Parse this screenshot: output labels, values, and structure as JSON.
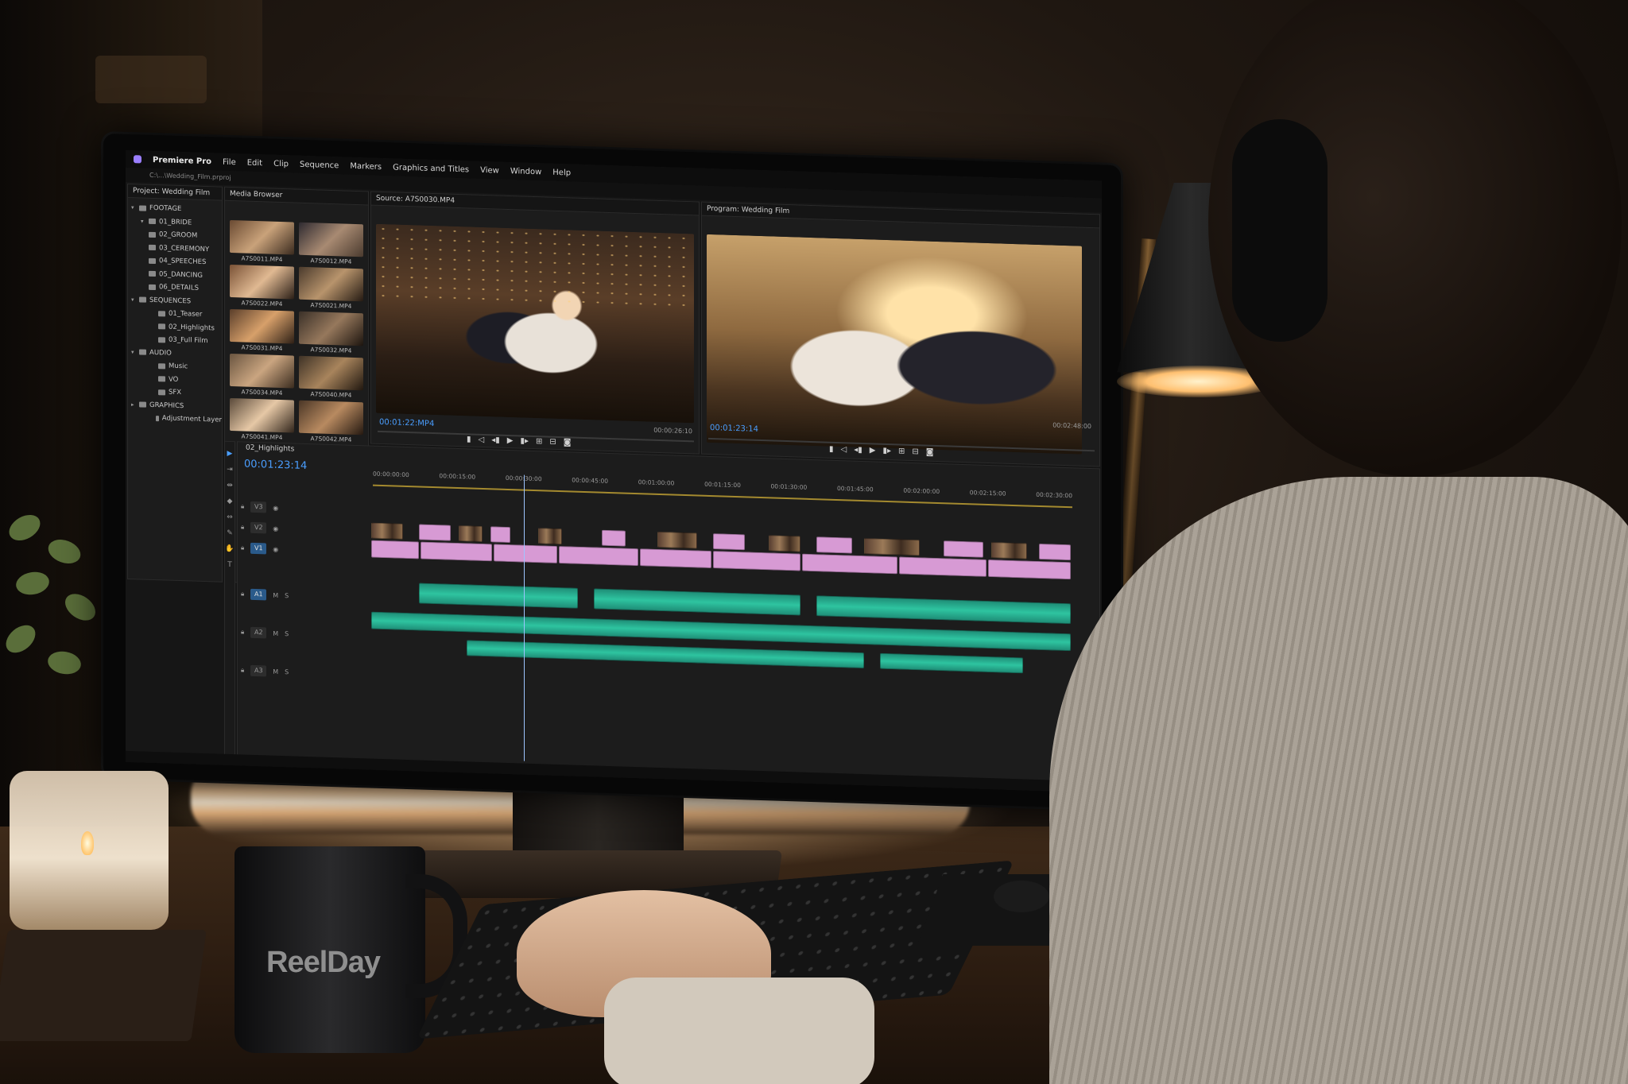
{
  "app": {
    "name": "Premiere Pro",
    "path": "C:\\...\\Wedding_Film.prproj"
  },
  "menu": [
    "File",
    "Edit",
    "Clip",
    "Sequence",
    "Markers",
    "Graphics and Titles",
    "View",
    "Window",
    "Help"
  ],
  "project_panel": {
    "title": "Project: Wedding Film",
    "tree": [
      {
        "label": "FOOTAGE",
        "level": 0,
        "open": true
      },
      {
        "label": "01_BRIDE",
        "level": 1,
        "open": true
      },
      {
        "label": "02_GROOM",
        "level": 1
      },
      {
        "label": "03_CEREMONY",
        "level": 1
      },
      {
        "label": "04_SPEECHES",
        "level": 1
      },
      {
        "label": "05_DANCING",
        "level": 1
      },
      {
        "label": "06_DETAILS",
        "level": 1
      },
      {
        "label": "SEQUENCES",
        "level": 0,
        "open": true
      },
      {
        "label": "01_Teaser",
        "level": 2
      },
      {
        "label": "02_Highlights",
        "level": 2
      },
      {
        "label": "03_Full Film",
        "level": 2
      },
      {
        "label": "AUDIO",
        "level": 0,
        "open": true
      },
      {
        "label": "Music",
        "level": 2
      },
      {
        "label": "VO",
        "level": 2
      },
      {
        "label": "SFX",
        "level": 2
      },
      {
        "label": "GRAPHICS",
        "level": 0
      },
      {
        "label": "Adjustment Layer",
        "level": 2
      }
    ]
  },
  "media_browser": {
    "title": "Media Browser",
    "thumbnails": [
      "A7S0011.MP4",
      "A7S0012.MP4",
      "A7S0022.MP4",
      "A7S0021.MP4",
      "A7S0031.MP4",
      "A7S0032.MP4",
      "A7S0034.MP4",
      "A7S0040.MP4",
      "A7S0041.MP4",
      "A7S0042.MP4"
    ]
  },
  "source_monitor": {
    "title": "Source: A7S0030.MP4",
    "timecode": "00:01:22:MP4",
    "duration": "00:00:26:10"
  },
  "program_monitor": {
    "title": "Program: Wedding Film",
    "timecode": "00:01:23:14",
    "duration": "00:02:48:00"
  },
  "timeline": {
    "sequence": "02_Highlights",
    "timecode": "00:01:23:14",
    "ruler": [
      "00:00:00:00",
      "00:00:15:00",
      "00:00:30:00",
      "00:00:45:00",
      "00:01:00:00",
      "00:01:15:00",
      "00:01:30:00",
      "00:01:45:00",
      "00:02:00:00",
      "00:02:15:00",
      "00:02:30:00"
    ],
    "tracks": [
      "V3",
      "V2",
      "V1",
      "A1",
      "A2",
      "A3"
    ]
  },
  "mug": {
    "text": "ReelDay"
  },
  "colors": {
    "timecode": "#4a9eff",
    "video_clip": "#d79ad4",
    "audio_clip": "#2ec4a0"
  }
}
